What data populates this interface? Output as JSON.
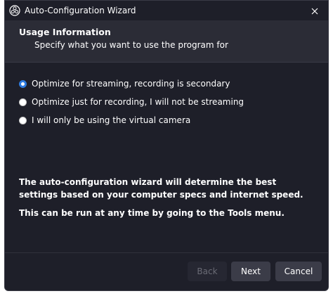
{
  "window": {
    "title": "Auto-Configuration Wizard",
    "icon": "obs-logo-icon",
    "close_icon": "close-icon"
  },
  "header": {
    "title": "Usage Information",
    "subtitle": "Specify what you want to use the program for"
  },
  "options": [
    {
      "label": "Optimize for streaming, recording is secondary",
      "checked": true
    },
    {
      "label": "Optimize just for recording, I will not be streaming",
      "checked": false
    },
    {
      "label": "I will only be using the virtual camera",
      "checked": false
    }
  ],
  "info": {
    "line1": "The auto-configuration wizard will determine the best settings based on your computer specs and internet speed.",
    "line2": "This can be run at any time by going to the Tools menu."
  },
  "buttons": {
    "back": "Back",
    "next": "Next",
    "cancel": "Cancel",
    "back_enabled": false
  },
  "colors": {
    "background": "#1e1f29",
    "header": "#2b2c36",
    "accent": "#2d7be0",
    "button": "#3b3c48"
  }
}
